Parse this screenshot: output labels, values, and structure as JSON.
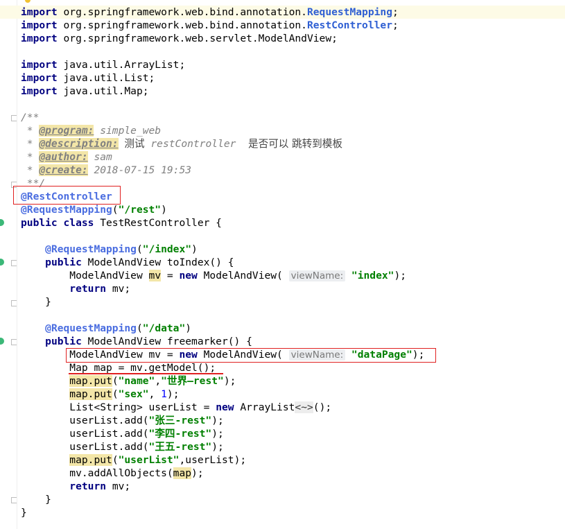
{
  "colors": {
    "keyword": "#000080",
    "annotation": "#808000",
    "string": "#008000",
    "comment": "#808080",
    "red_box": "#e02020"
  },
  "code": {
    "imports": [
      {
        "kw": "import",
        "pkg": "org.springframework.web.bind.annotation.",
        "cls": "RequestMapping",
        "end": ";"
      },
      {
        "kw": "import",
        "pkg": "org.springframework.web.bind.annotation.",
        "cls": "RestController",
        "end": ";"
      },
      {
        "kw": "import",
        "pkg": "org.springframework.web.servlet.ModelAndView;",
        "cls": "",
        "end": ""
      },
      {
        "kw": "import",
        "pkg": "java.util.ArrayList;",
        "cls": "",
        "end": ""
      },
      {
        "kw": "import",
        "pkg": "java.util.List;",
        "cls": "",
        "end": ""
      },
      {
        "kw": "import",
        "pkg": "java.util.Map;",
        "cls": "",
        "end": ""
      }
    ],
    "javadoc": {
      "open": "/**",
      "program_tag": "@program:",
      "program_val": "simple_web",
      "description_tag": "@description:",
      "description_cn1": "测试",
      "description_val": "restController",
      "description_cn2": "是否可以 跳转到模板",
      "author_tag": "@author:",
      "author_val": "sam",
      "create_tag": "@create:",
      "create_val": "2018-07-15 19:53",
      "close": "**/"
    },
    "class_annotation_1": "@RestController",
    "class_annotation_2": "@RequestMapping",
    "class_mapping_value": "\"/rest\"",
    "class_decl_kw": "public class",
    "class_name": "TestRestController {",
    "method1": {
      "annotation": "@RequestMapping",
      "mapping": "\"/index\"",
      "decl_kw": "public",
      "decl": "ModelAndView toIndex() {",
      "body_type": "ModelAndView",
      "var": "mv",
      "new_kw": "new",
      "ctor": "ModelAndView(",
      "hint": "viewName:",
      "arg": "\"index\"",
      "return_kw": "return",
      "return_val": "mv;",
      "close": "}"
    },
    "method2": {
      "annotation": "@RequestMapping",
      "mapping": "\"/data\"",
      "decl_kw": "public",
      "decl": "ModelAndView freemarker() {",
      "l1_type": "ModelAndView mv =",
      "l1_new": "new",
      "l1_ctor": "ModelAndView(",
      "l1_hint": "viewName:",
      "l1_arg": "\"dataPage\"",
      "l2": "Map map = mv.getModel();",
      "put": "map.put",
      "name_key": "\"name\"",
      "name_val": "\"世界—rest\"",
      "sex_key": "\"sex\"",
      "sex_val": "1",
      "list_decl": "List<String> userList =",
      "list_new": "new",
      "list_ctor": "ArrayList",
      "list_diamond": "<~>",
      "add": "userList.add(",
      "u1": "\"张三-rest\"",
      "u2": "\"李四-rest\"",
      "u3": "\"王五-rest\"",
      "ul_key": "\"userList\"",
      "ul_val": "userList",
      "addall": "mv.addAllObjects(",
      "map": "map",
      "return_kw": "return",
      "return_val": "mv;",
      "close": "}"
    },
    "class_close": "}"
  }
}
